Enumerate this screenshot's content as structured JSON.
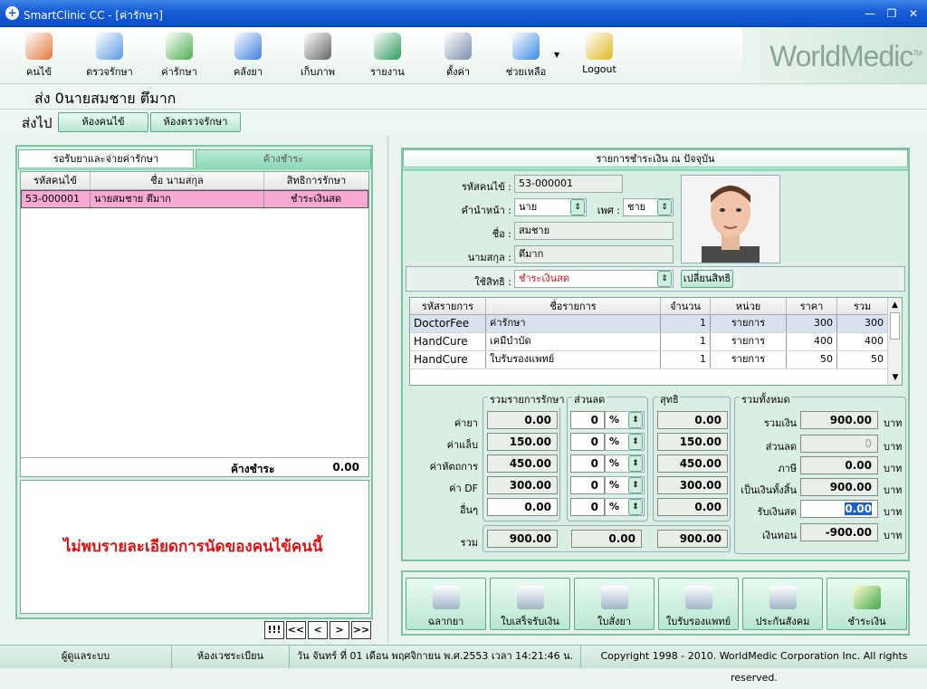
{
  "window": {
    "title": "SmartClinic CC - [ค่ารักษา]"
  },
  "toolbar": [
    {
      "label": "คนไข้",
      "icon": "patient-card-icon",
      "color": "#e07a3a"
    },
    {
      "label": "ตรวจรักษา",
      "icon": "doctor-icon",
      "color": "#5a9be0"
    },
    {
      "label": "ค่ารักษา",
      "icon": "money-icon",
      "color": "#4fae4f"
    },
    {
      "label": "คลังยา",
      "icon": "pill-icon",
      "color": "#3f7fe0"
    },
    {
      "label": "เก็บภาพ",
      "icon": "camera-icon",
      "color": "#666666"
    },
    {
      "label": "รายงาน",
      "icon": "bar-chart-icon",
      "color": "#2f9a5f"
    },
    {
      "label": "ตั้งค่า",
      "icon": "tools-icon",
      "color": "#7a8fb0"
    },
    {
      "label": "ช่วยเหลือ",
      "icon": "help-icon",
      "color": "#3a8ae0"
    },
    {
      "label": "Logout",
      "icon": "lock-icon",
      "color": "#e0b820"
    }
  ],
  "brand": "WorldMedic",
  "brand_tm": "TM",
  "send": {
    "line": "ส่ง 0นายสมชาย ตึมาก",
    "goto": "ส่งไป",
    "btn1": "ห้องคนไข้",
    "btn2": "ห้องตรวจรักษา"
  },
  "left": {
    "tab1": "รอรับยาและจ่ายค่ารักษา",
    "tab2": "ค้างชำระ",
    "cols": [
      "รหัสคนไข้",
      "ชื่อ นามสกุล",
      "สิทธิการรักษา"
    ],
    "rows": [
      {
        "id": "53-000001",
        "name": "นายสมชาย ตึมาก",
        "right": "ชำระเงินสด"
      }
    ],
    "outstanding_label": "ค้างชำระ",
    "outstanding_value": "0.00",
    "no_detail": "ไม่พบรายละเอียดการนัดของคนไข้คนนี้",
    "nav": [
      "!!!",
      "<<",
      "<",
      ">",
      ">>"
    ]
  },
  "right": {
    "title": "รายการชำระเงิน ณ ปัจจุบัน",
    "patient_id_label": "รหัสคนไข้ :",
    "patient_id": "53-000001",
    "prefix_label": "คำนำหน้า :",
    "prefix": "นาย",
    "sex_label": "เพศ :",
    "sex": "ชาย",
    "fname_label": "ชื่อ :",
    "fname": "สมชาย",
    "lname_label": "นามสกุล :",
    "lname": "ตึมาก",
    "right_label": "ใช้สิทธิ :",
    "right_value": "ชำระเงินสด",
    "change_right": "เปลี่ยนสิทธิ",
    "item_cols": [
      "รหัสรายการ",
      "ชื่อรายการ",
      "จำนวน",
      "หน่วย",
      "ราคา",
      "รวม"
    ],
    "items": [
      {
        "code": "DoctorFee",
        "name": "ค่ารักษา",
        "qty": "1",
        "unit": "รายการ",
        "price": "300",
        "total": "300"
      },
      {
        "code": "HandCure",
        "name": "เคมีบำบัด",
        "qty": "1",
        "unit": "รายการ",
        "price": "400",
        "total": "400"
      },
      {
        "code": "HandCure",
        "name": "ใบรับรองแพทย์",
        "qty": "1",
        "unit": "รายการ",
        "price": "50",
        "total": "50"
      }
    ],
    "sum_title": "รวมรายการรักษา",
    "disc_title": "ส่วนลด",
    "net_title": "สุทธิ",
    "total_title": "รวมทั้งหมด",
    "sum_rows": [
      {
        "label": "ค่ายา",
        "amount": "0.00",
        "disc": "0",
        "net": "0.00"
      },
      {
        "label": "ค่าแล็บ",
        "amount": "150.00",
        "disc": "0",
        "net": "150.00"
      },
      {
        "label": "ค่าหัตถการ",
        "amount": "450.00",
        "disc": "0",
        "net": "450.00"
      },
      {
        "label": "ค่า DF",
        "amount": "300.00",
        "disc": "0",
        "net": "300.00"
      },
      {
        "label": "อื่นๆ",
        "amount": "0.00",
        "disc": "0",
        "net": "0.00"
      }
    ],
    "pct": "%",
    "grand_label": "รวม",
    "grand_amount": "900.00",
    "grand_disc": "0.00",
    "grand_net": "900.00",
    "totals": [
      {
        "label": "รวมเงิน",
        "value": "900.00"
      },
      {
        "label": "ส่วนลด",
        "value": "0"
      },
      {
        "label": "ภาษี",
        "value": "0.00"
      },
      {
        "label": "เป็นเงินทั้งสิ้น",
        "value": "900.00"
      },
      {
        "label": "รับเงินสด",
        "value": "0.00"
      },
      {
        "label": "เงินทอน",
        "value": "-900.00"
      }
    ],
    "baht": "บาท"
  },
  "actions": [
    {
      "label": "ฉลากยา",
      "icon": "printer-icon"
    },
    {
      "label": "ใบเสร็จรับเงิน",
      "icon": "printer-icon"
    },
    {
      "label": "ใบสั่งยา",
      "icon": "printer-icon"
    },
    {
      "label": "ใบรับรองแพทย์",
      "icon": "printer-icon"
    },
    {
      "label": "ประกันสังคม",
      "icon": "printer-icon"
    },
    {
      "label": "ชำระเงิน",
      "icon": "money-icon"
    }
  ],
  "status": {
    "user": "ผู้ดูแลระบบ",
    "room": "ห้องเวชระเบียน",
    "datetime": "วัน จันทร์ ที่ 01 เดือน พฤศจิกายน พ.ศ.2553 เวลา 14:21:46 น.",
    "copyright": "Copyright 1998 - 2010. WorldMedic Corporation Inc. All rights reserved."
  }
}
